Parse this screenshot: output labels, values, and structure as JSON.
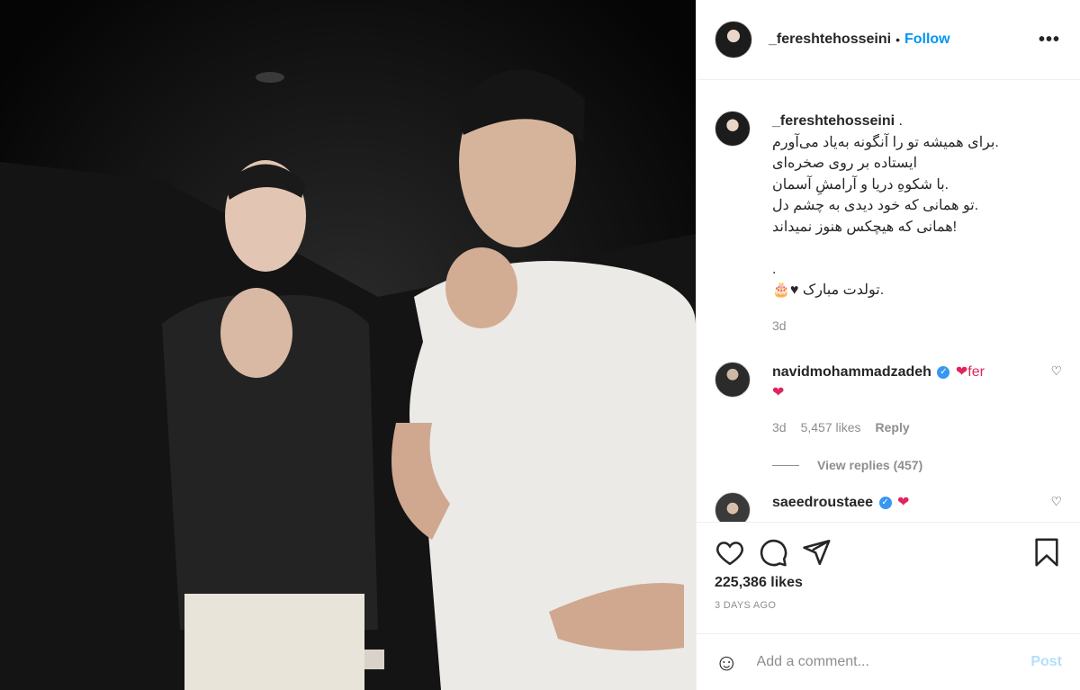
{
  "header": {
    "username": "_fereshtehosseini",
    "separator": "•",
    "follow_label": "Follow",
    "more_label": "•••"
  },
  "caption": {
    "username": "_fereshtehosseini",
    "suffix": " .",
    "lines": [
      "برای همیشه تو را آنگونه به‌یاد می‌آورم.",
      "ایستاده بر روی صخره‌ای",
      "با شکوهِ دریا و آرامشِ آسمان.",
      "تو همانی که خود دیدی به چشم دل.",
      "همانی که هیچکس هنوز نمیداند!",
      "",
      ".",
      "🎂♥ تولدت مبارک."
    ],
    "time": "3d"
  },
  "comments": [
    {
      "username": "navidmohammadzadeh",
      "text": "❤fer",
      "text2": "❤",
      "time": "3d",
      "likes": "5,457 likes",
      "reply_label": "Reply",
      "view_replies": "View replies (457)"
    },
    {
      "username": "saeedroustaee",
      "text": "❤"
    }
  ],
  "actions": {
    "likes": "225,386 likes",
    "ago": "3 DAYS AGO"
  },
  "add_comment": {
    "placeholder": "Add a comment...",
    "post_label": "Post",
    "emoji": "☺"
  },
  "colors": {
    "accent": "#0095f6",
    "post_disabled": "#b2dffc",
    "verified": "#3897f0",
    "heart": "#e0245e"
  }
}
